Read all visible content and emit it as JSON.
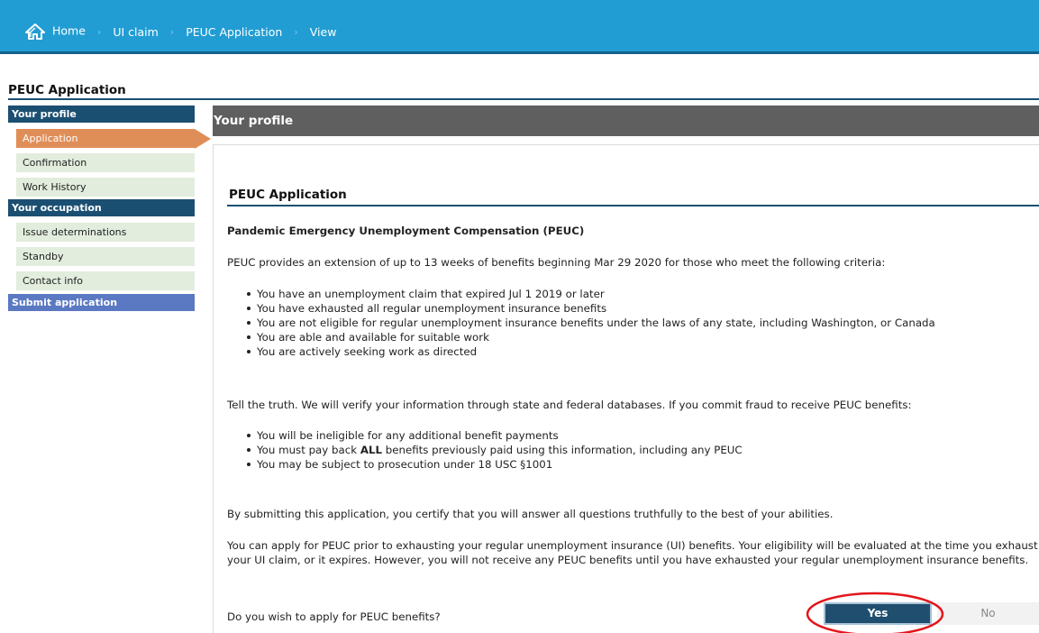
{
  "breadcrumb": {
    "items": [
      "Home",
      "UI claim",
      "PEUC Application",
      "View"
    ],
    "separator": "›"
  },
  "page_title": "PEUC Application",
  "sidebar": {
    "profile_header": "Your profile",
    "profile_items": [
      "Application",
      "Confirmation",
      "Work History"
    ],
    "occupation_header": "Your occupation",
    "occupation_items": [
      "Issue determinations",
      "Standby",
      "Contact info"
    ],
    "submit": "Submit application"
  },
  "content": {
    "header": "Your profile",
    "section_title": "PEUC Application",
    "subtitle": "Pandemic Emergency Unemployment Compensation (PEUC)",
    "intro": "PEUC provides an extension of up to 13 weeks of benefits beginning Mar 29 2020 for those who meet the following criteria:",
    "criteria": [
      "You have an unemployment claim that expired Jul 1 2019 or later",
      "You have exhausted all regular unemployment insurance benefits",
      "You are not eligible for regular unemployment insurance benefits under the laws of any state, including Washington, or Canada",
      "You are able and available for suitable work",
      "You are actively seeking work as directed"
    ],
    "truth": "Tell the truth. We will verify your information through state and federal databases. If you commit fraud to receive PEUC benefits:",
    "fraud": {
      "item1": "You will be ineligible for any additional benefit payments",
      "item2_pre": "You must pay back ",
      "item2_bold": "ALL",
      "item2_post": " benefits previously paid using this information, including any PEUC",
      "item3": "You may be subject to prosecution under 18 USC §1001"
    },
    "certify": "By submitting this application, you certify that you will answer all questions truthfully to the best of your abilities.",
    "apply_note": "You can apply for PEUC prior to exhausting your regular unemployment insurance (UI) benefits. Your eligibility will be evaluated at the time you exhaust your UI claim, or it expires. However, you will not receive any PEUC benefits until you have exhausted your regular unemployment insurance benefits.",
    "question": "Do you wish to apply for PEUC benefits?",
    "yes_label": "Yes",
    "no_label": "No"
  },
  "colors": {
    "topbar": "#219dd3",
    "navy": "#1b4f72",
    "active_tab": "#e08e58",
    "side_item_bg": "#e2eddd",
    "submit_bg": "#5b78c2",
    "annotation_circle": "#e3151a"
  },
  "icons": {
    "home": "home-icon"
  }
}
